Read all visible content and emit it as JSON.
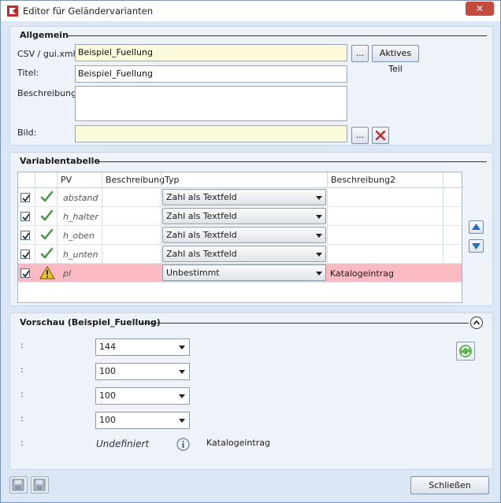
{
  "window": {
    "title": "Editor für Geländervarianten",
    "close_symbol": "✕"
  },
  "allgemein": {
    "group_title": "Allgemein",
    "csv_label": "CSV / gui.xml:",
    "csv_value": "Beispiel_Fuellung",
    "browse_label": "...",
    "active_part_label": "Aktives Teil",
    "titel_label": "Titel:",
    "titel_value": "Beispiel_Fuellung",
    "beschreibung_label": "Beschreibung:",
    "beschreibung_value": "",
    "bild_label": "Bild:",
    "bild_value": "",
    "bild_browse_label": "..."
  },
  "variablentabelle": {
    "group_title": "Variablentabelle",
    "columns": [
      "PV",
      "Beschreibung",
      "Typ",
      "Beschreibung2"
    ],
    "rows": [
      {
        "checked": true,
        "status": "ok",
        "pv": "abstand",
        "beschreibung": "",
        "typ": "Zahl als Textfeld",
        "beschreibung2": ""
      },
      {
        "checked": true,
        "status": "ok",
        "pv": "h_halter",
        "beschreibung": "",
        "typ": "Zahl als Textfeld",
        "beschreibung2": ""
      },
      {
        "checked": true,
        "status": "ok",
        "pv": "h_oben",
        "beschreibung": "",
        "typ": "Zahl als Textfeld",
        "beschreibung2": ""
      },
      {
        "checked": true,
        "status": "ok",
        "pv": "h_unten",
        "beschreibung": "",
        "typ": "Zahl als Textfeld",
        "beschreibung2": ""
      },
      {
        "checked": true,
        "status": "warning",
        "pv": "pl",
        "beschreibung": "",
        "typ": "Unbestimmt",
        "beschreibung2": "Katalogeintrag"
      }
    ]
  },
  "vorschau": {
    "group_title": "Vorschau (Beispiel_Fuellung)",
    "colon": ":",
    "values": [
      "144",
      "100",
      "100",
      "100"
    ],
    "undefined_label": "Undefiniert",
    "katalog_label": "Katalogeintrag"
  },
  "footer": {
    "close_label": "Schließen"
  },
  "colors": {
    "panel_bg": "#eef3fa",
    "window_bg": "#dce7f5",
    "error_row": "#fbb9c2",
    "yellow_field": "#fbfbdb",
    "close_red": "#c74b3c"
  }
}
